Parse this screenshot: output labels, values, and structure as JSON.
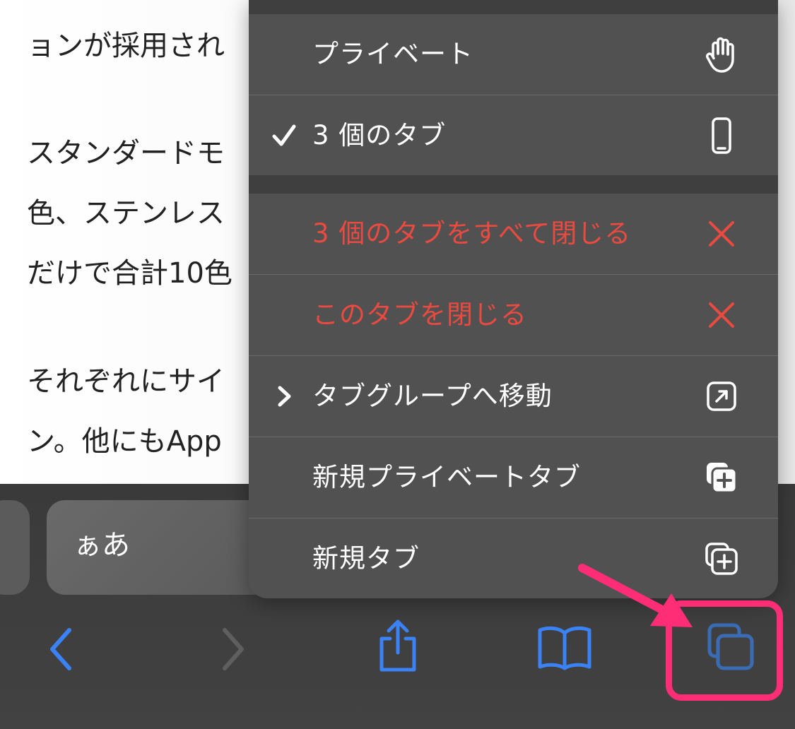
{
  "article": {
    "lines": [
      "ョンが採用され",
      "スタンダードモ",
      "色、ステンレス",
      "だけで合計10色",
      "それぞれにサイ",
      "ン。他にもApp"
    ]
  },
  "toolbar": {
    "url_label": "ぁあ",
    "back_icon": "chevron-left-icon",
    "forward_icon": "chevron-right-icon",
    "share_icon": "share-icon",
    "bookmarks_icon": "book-icon",
    "tabs_icon": "tabs-icon",
    "colors": {
      "accent": "#3b82f6",
      "disabled": "#5f5f5f",
      "highlight": "#ff2d75"
    }
  },
  "menu": {
    "items": [
      {
        "label": "プライベート",
        "icon": "hand-icon",
        "checked": false,
        "submenu": false,
        "destructive": false
      },
      {
        "label": "3 個のタブ",
        "icon": "phone-icon",
        "checked": true,
        "submenu": false,
        "destructive": false
      },
      {
        "label": "3 個のタブをすべて閉じる",
        "icon": "close-icon",
        "checked": false,
        "submenu": false,
        "destructive": true
      },
      {
        "label": "このタブを閉じる",
        "icon": "close-icon",
        "checked": false,
        "submenu": false,
        "destructive": true
      },
      {
        "label": "タブグループへ移動",
        "icon": "move-to-icon",
        "checked": false,
        "submenu": true,
        "destructive": false
      },
      {
        "label": "新規プライベートタブ",
        "icon": "private-tab-plus-icon",
        "checked": false,
        "submenu": false,
        "destructive": false
      },
      {
        "label": "新規タブ",
        "icon": "new-tab-plus-icon",
        "checked": false,
        "submenu": false,
        "destructive": false
      }
    ],
    "colors": {
      "destructive": "#ea4a3f",
      "text": "#ffffff"
    }
  }
}
